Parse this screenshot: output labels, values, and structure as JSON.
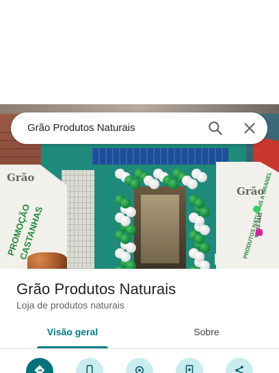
{
  "search": {
    "query": "Grão Produtos Naturais",
    "search_icon": "search-icon",
    "clear_icon": "close-icon"
  },
  "photo": {
    "left_banner": {
      "brand": "Grão",
      "line1": "PROMOÇÃO",
      "line2": "CASTANHAS"
    },
    "right_banner": {
      "brand": "Grão",
      "line1": "PRODUTOS NATURAIS A GRANEL",
      "phone": "99922.5441"
    }
  },
  "place": {
    "name": "Grão Produtos Naturais",
    "category": "Loja de produtos naturais"
  },
  "tabs": [
    {
      "label": "Visão geral",
      "selected": true
    },
    {
      "label": "Sobre",
      "selected": false
    }
  ],
  "actions": [
    {
      "icon": "directions-icon"
    },
    {
      "icon": "phone-icon"
    },
    {
      "icon": "location-icon"
    },
    {
      "icon": "save-icon"
    },
    {
      "icon": "share-icon"
    }
  ],
  "colors": {
    "accent": "#007b83",
    "action_bg": "#c8ecef",
    "action_primary": "#00727a",
    "text_primary": "#202124",
    "text_secondary": "#5f6368"
  }
}
